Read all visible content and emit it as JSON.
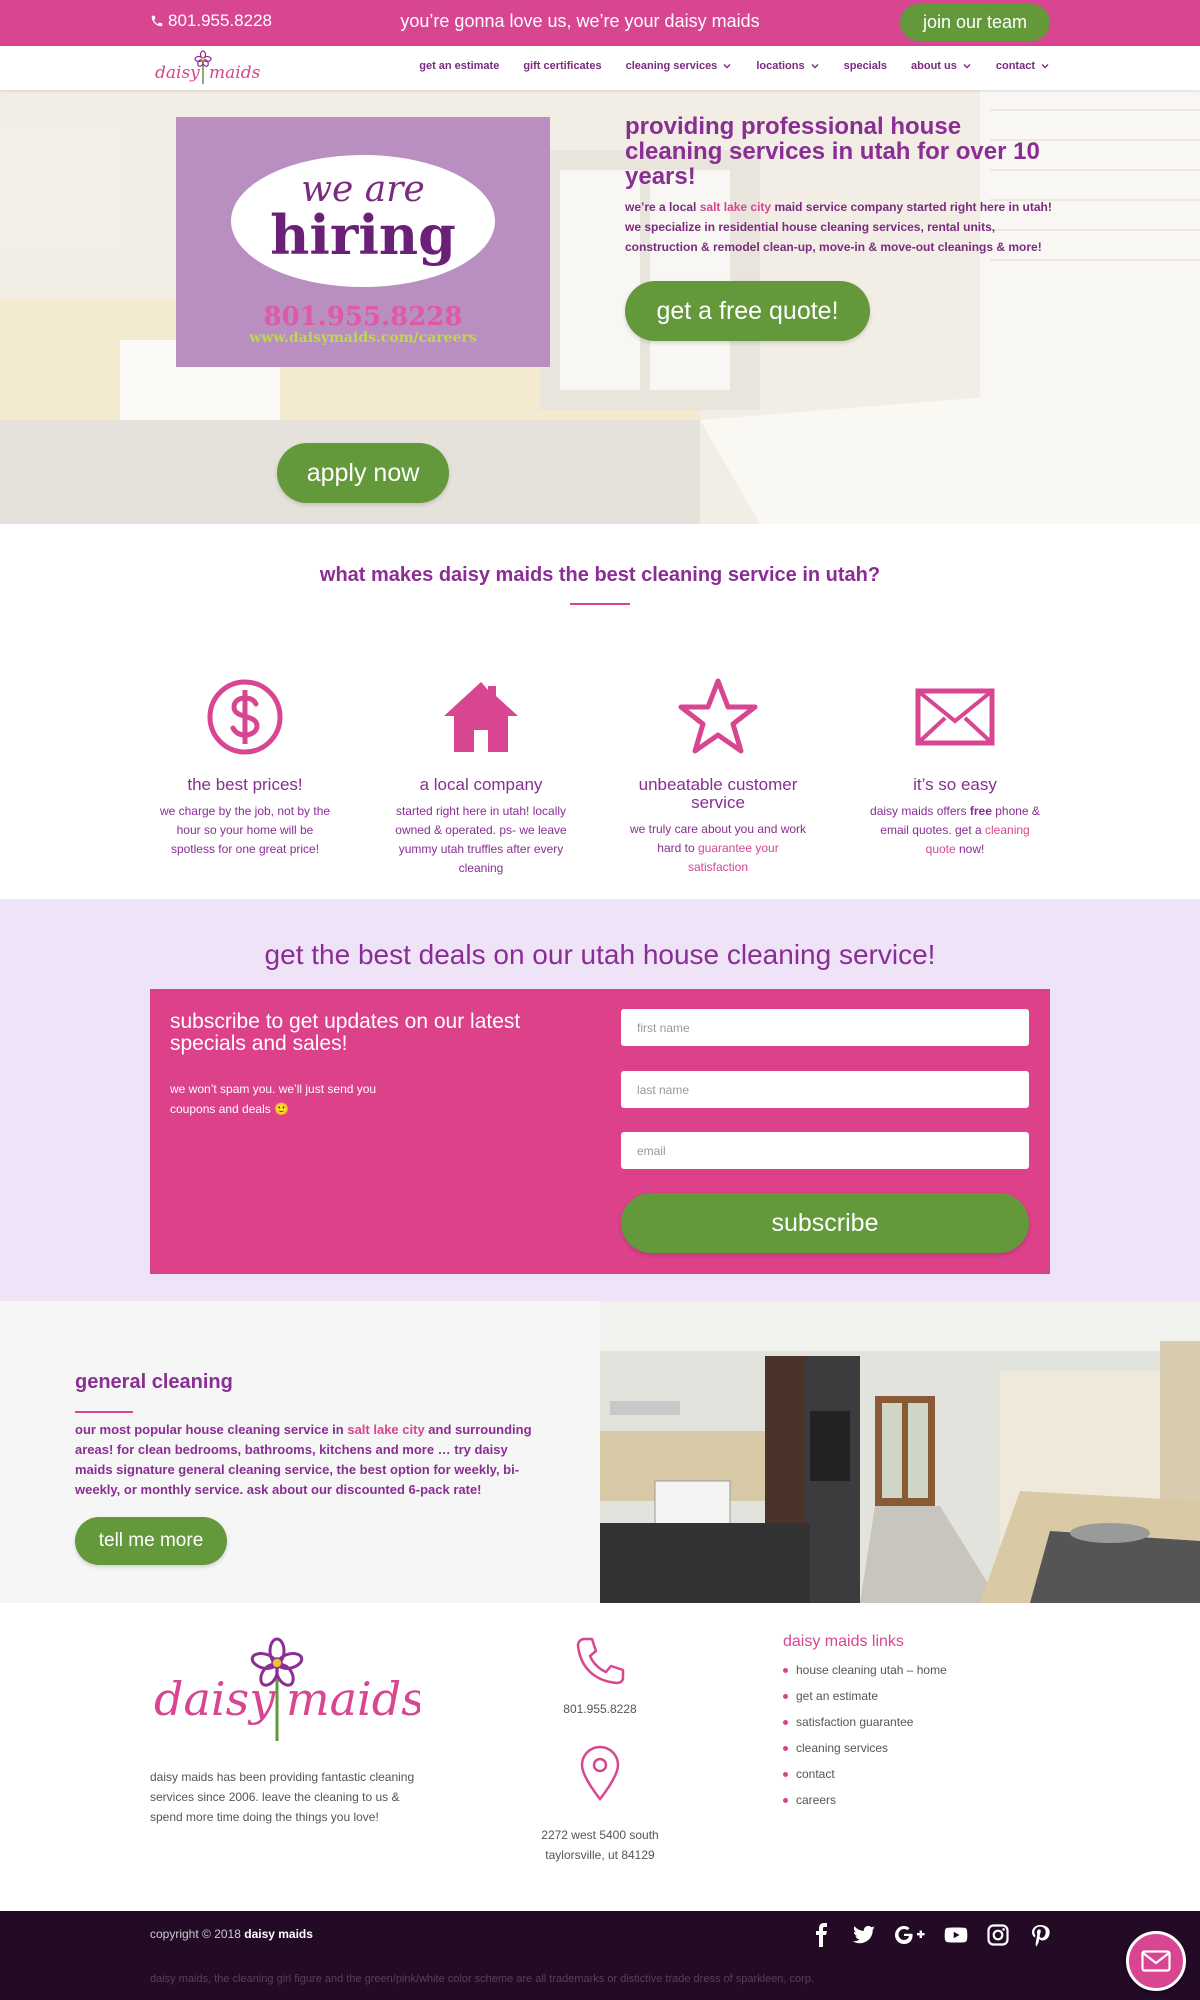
{
  "topbar": {
    "phone": "801.955.8228",
    "tagline": "you’re gonna love us, we’re your daisy maids",
    "join_label": "join our team"
  },
  "nav": {
    "logo_text": "daisy maids",
    "items": [
      {
        "label": "get an estimate",
        "dropdown": false
      },
      {
        "label": "gift certificates",
        "dropdown": false
      },
      {
        "label": "cleaning services",
        "dropdown": true
      },
      {
        "label": "locations",
        "dropdown": true
      },
      {
        "label": "specials",
        "dropdown": false
      },
      {
        "label": "about us",
        "dropdown": true
      },
      {
        "label": "contact",
        "dropdown": true
      }
    ]
  },
  "hero": {
    "hiring": {
      "line1": "we are",
      "line2": "hiring",
      "phone": "801.955.8228",
      "url": "www.daisymaids.com/careers"
    },
    "heading": "providing professional house cleaning services in utah for over 10 years!",
    "intro_before": "we’re a local ",
    "intro_link": "salt lake city",
    "intro_after": " maid service company started right here in utah! we specialize in residential house cleaning services, rental units, construction & remodel clean-up, move-in & move-out cleanings & more!",
    "quote_button": "get a free quote!",
    "apply_button": "apply now"
  },
  "why": {
    "heading": "what makes daisy maids the best cleaning service in utah?",
    "features": [
      {
        "icon": "dollar-icon",
        "title": "the best prices!",
        "desc": "we charge by the job, not by the hour so your home will be spotless for one great price!"
      },
      {
        "icon": "house-icon",
        "title": "a local company",
        "desc": "started right here in utah! locally owned & operated. ps- we leave yummy utah truffles after every cleaning"
      },
      {
        "icon": "star-icon",
        "title": "unbeatable customer service",
        "desc_before": "we truly care about you and work hard to ",
        "desc_link": "guarantee your satisfaction"
      },
      {
        "icon": "envelope-icon",
        "title": "it’s so easy",
        "desc_before": "daisy maids offers ",
        "desc_bold": "free",
        "desc_mid": " phone & email quotes. get a ",
        "desc_link": "cleaning quote",
        "desc_after": " now!"
      }
    ]
  },
  "deals": {
    "heading": "get the best deals on our utah house cleaning service!",
    "sub_title": "subscribe to get updates on our latest specials and sales!",
    "sub_desc": "we won’t spam you. we’ll just send you coupons and deals 🙂",
    "first_name_placeholder": "first name",
    "last_name_placeholder": "last name",
    "email_placeholder": "email",
    "subscribe_button": "subscribe"
  },
  "general": {
    "heading": "general cleaning",
    "desc_before": "our most popular house cleaning service in ",
    "desc_link": "salt lake city",
    "desc_after": " and surrounding areas! for clean bedrooms, bathrooms, kitchens and more … try daisy maids signature general cleaning service, the best option for weekly, bi-weekly, or monthly service. ask about our discounted 6-pack rate!",
    "button": "tell me more"
  },
  "footer": {
    "about": "daisy maids has been providing fantastic cleaning services since 2006. leave the cleaning to us & spend more time doing the things you love!",
    "phone": "801.955.8228",
    "address_line1": "2272 west 5400 south",
    "address_line2": "taylorsville, ut 84129",
    "links_heading": "daisy maids links",
    "links": [
      "house cleaning utah – home",
      "get an estimate",
      "satisfaction guarantee",
      "cleaning services",
      "contact",
      "careers"
    ]
  },
  "bottom": {
    "copyright_prefix": "copyright © 2018 ",
    "copyright_brand": "daisy maids",
    "trademark": "daisy maids, the cleaning girl figure and the green/pink/white color scheme are all trademarks or distictive trade dress of sparkleen, corp.",
    "social": [
      "facebook-icon",
      "twitter-icon",
      "google-plus-icon",
      "youtube-icon",
      "instagram-icon",
      "pinterest-icon"
    ]
  },
  "colors": {
    "brand_pink": "#d84591",
    "brand_purple": "#8a2d94",
    "brand_green": "#63993a",
    "lavender": "#efe4f7",
    "footer_dark": "#230b26"
  }
}
